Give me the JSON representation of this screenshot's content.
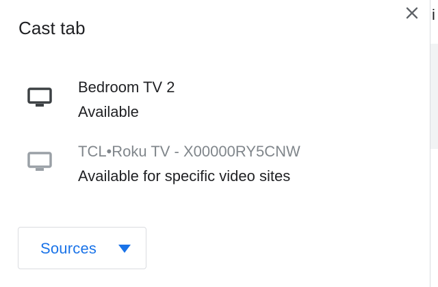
{
  "dialog": {
    "title": "Cast tab",
    "close_icon": "close-icon"
  },
  "sinks": [
    {
      "name": "Bedroom TV 2",
      "status": "Available",
      "icon": "tv-icon",
      "name_color": "#202124",
      "icon_color": "#3c4043"
    },
    {
      "name": "TCL•Roku TV - X00000RY5CNW",
      "status": "Available for specific video sites",
      "icon": "tv-icon",
      "name_color": "#80868b",
      "icon_color": "#9aa0a6"
    }
  ],
  "sources_button": {
    "label": "Sources",
    "icon": "dropdown-caret-icon",
    "color": "#1a73e8"
  },
  "background_fragment": {
    "text": "i"
  }
}
